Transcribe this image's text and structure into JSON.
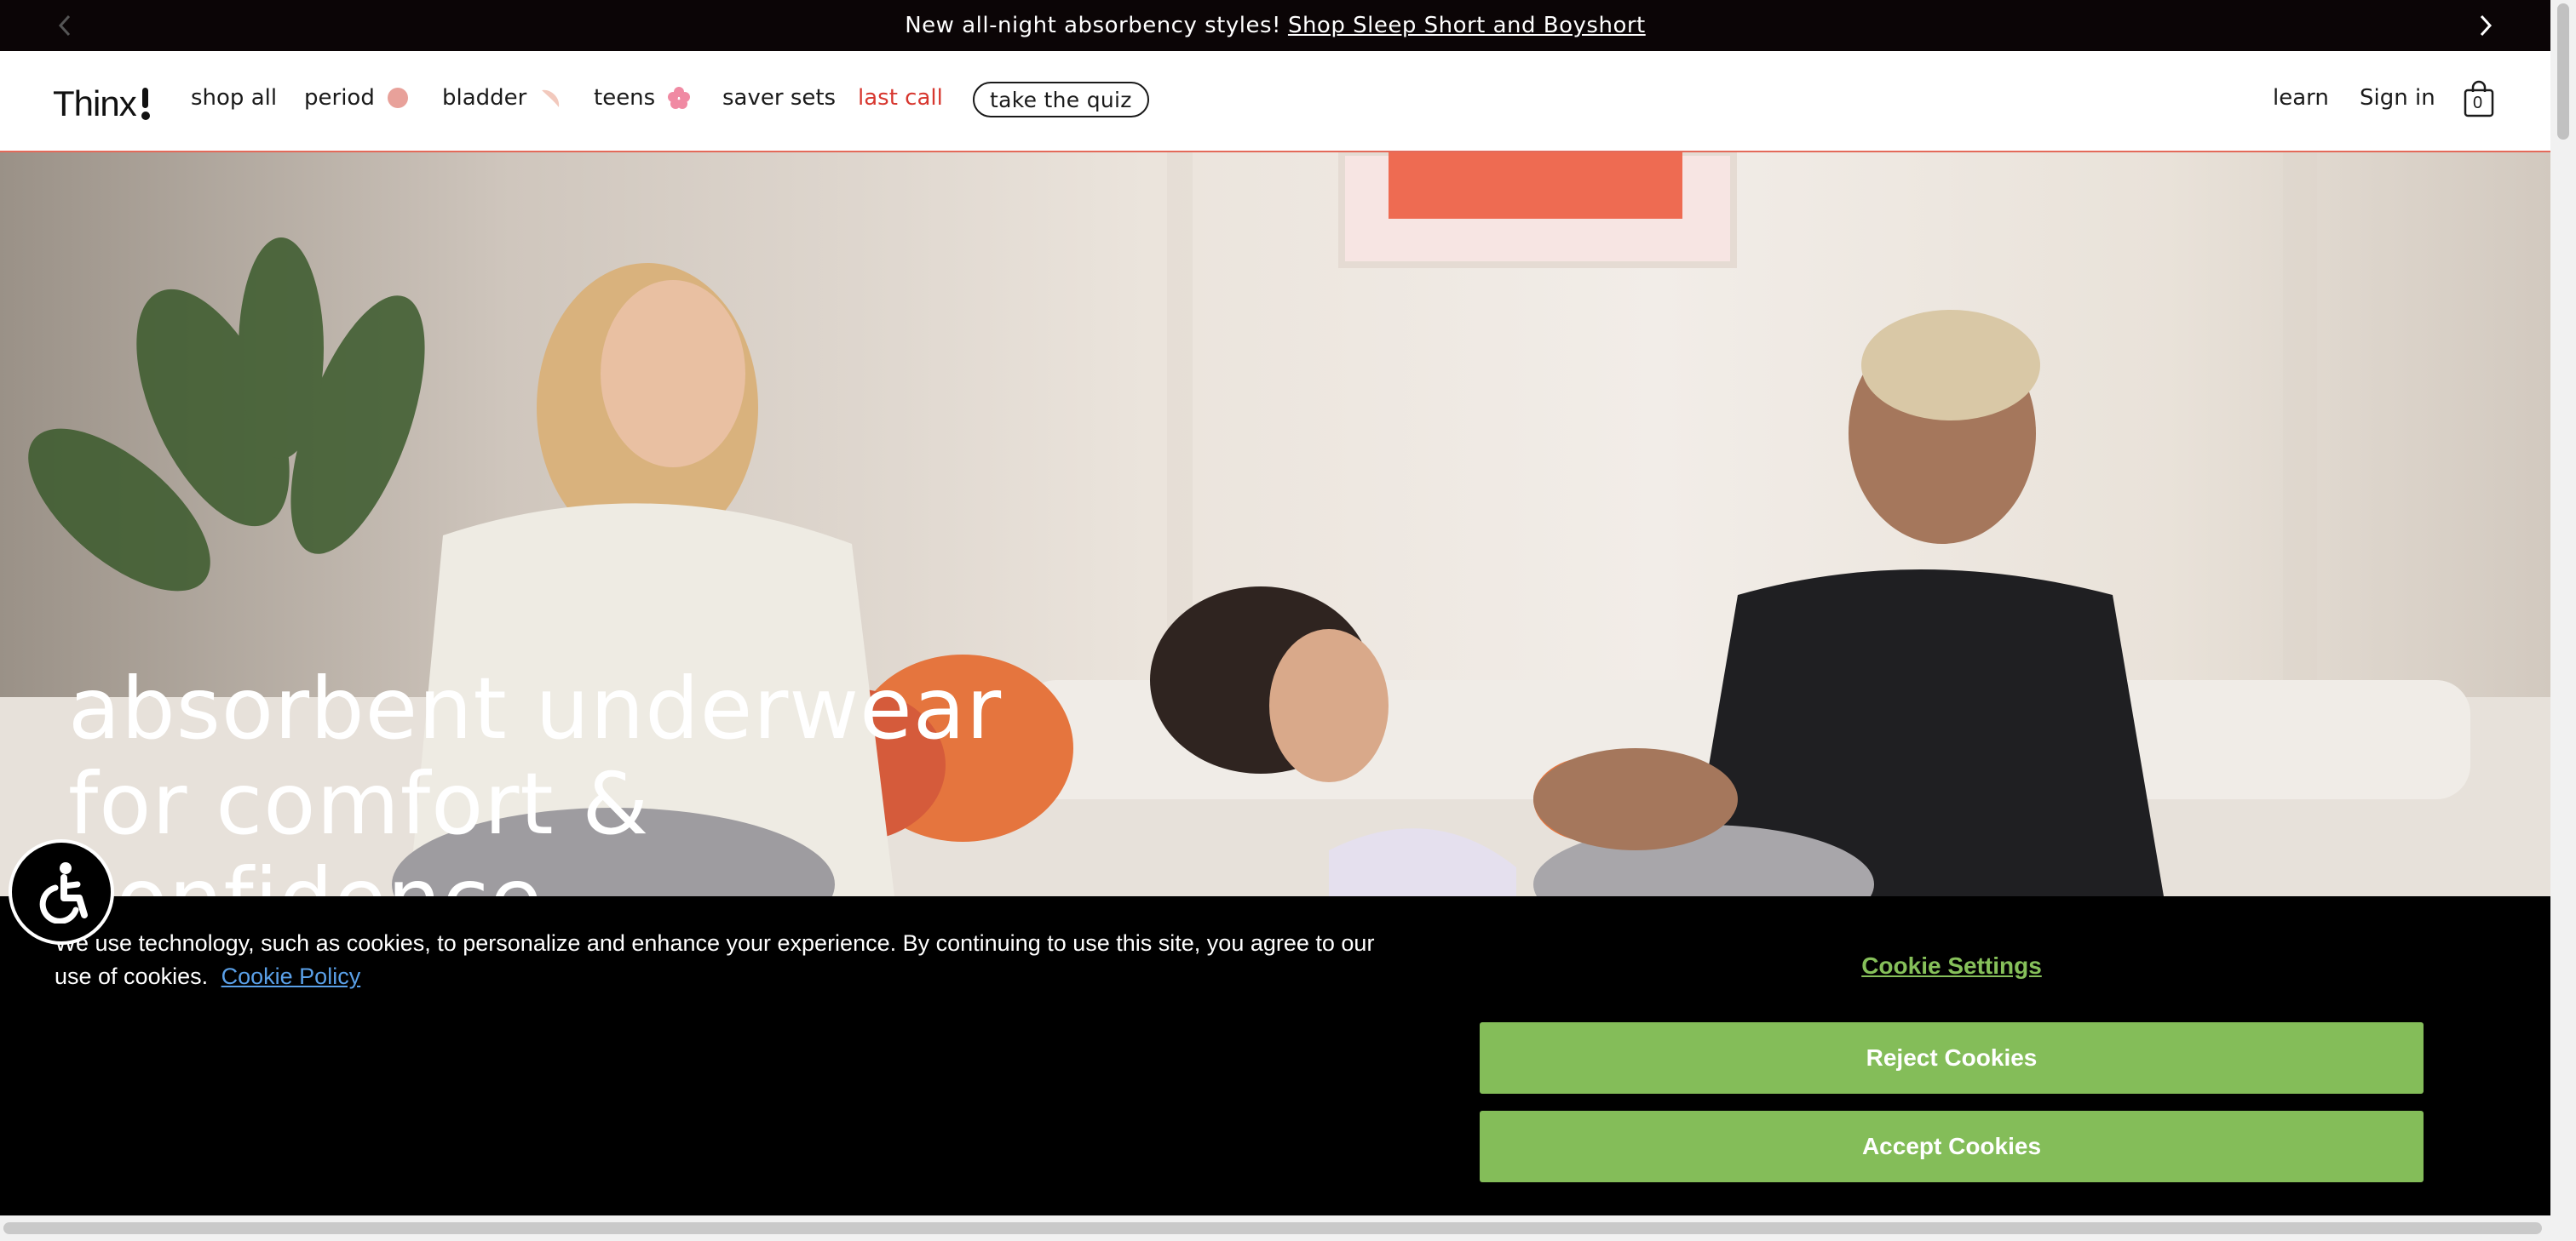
{
  "announcement": {
    "text": "New all-night absorbency styles!",
    "link_text": "Shop Sleep Short and Boyshort"
  },
  "nav": {
    "logo": "Thinx",
    "items": [
      {
        "label": "shop all"
      },
      {
        "label": "period",
        "icon": "circle-icon",
        "icon_color": "#e8a19a"
      },
      {
        "label": "bladder",
        "icon": "crescent-icon",
        "icon_color": "#f2c9bd"
      },
      {
        "label": "teens",
        "icon": "flower-icon",
        "icon_color": "#f08aa3"
      },
      {
        "label": "saver sets"
      },
      {
        "label": "last call",
        "color": "#d7372f"
      }
    ],
    "quiz_button": "take the quiz",
    "right": {
      "learn": "learn",
      "sign_in": "Sign in",
      "cart_count": "0"
    }
  },
  "hero": {
    "headline": "absorbent underwear\nfor comfort &\nconfidence"
  },
  "cookie_banner": {
    "message": "We use technology, such as cookies, to personalize and enhance your experience. By continuing to use this site, you agree to our use of cookies.",
    "policy_link": "Cookie Policy",
    "settings": "Cookie Settings",
    "reject": "Reject Cookies",
    "accept": "Accept Cookies",
    "accent_color": "#84bd59"
  },
  "accessibility": {
    "icon": "accessibility-icon"
  }
}
